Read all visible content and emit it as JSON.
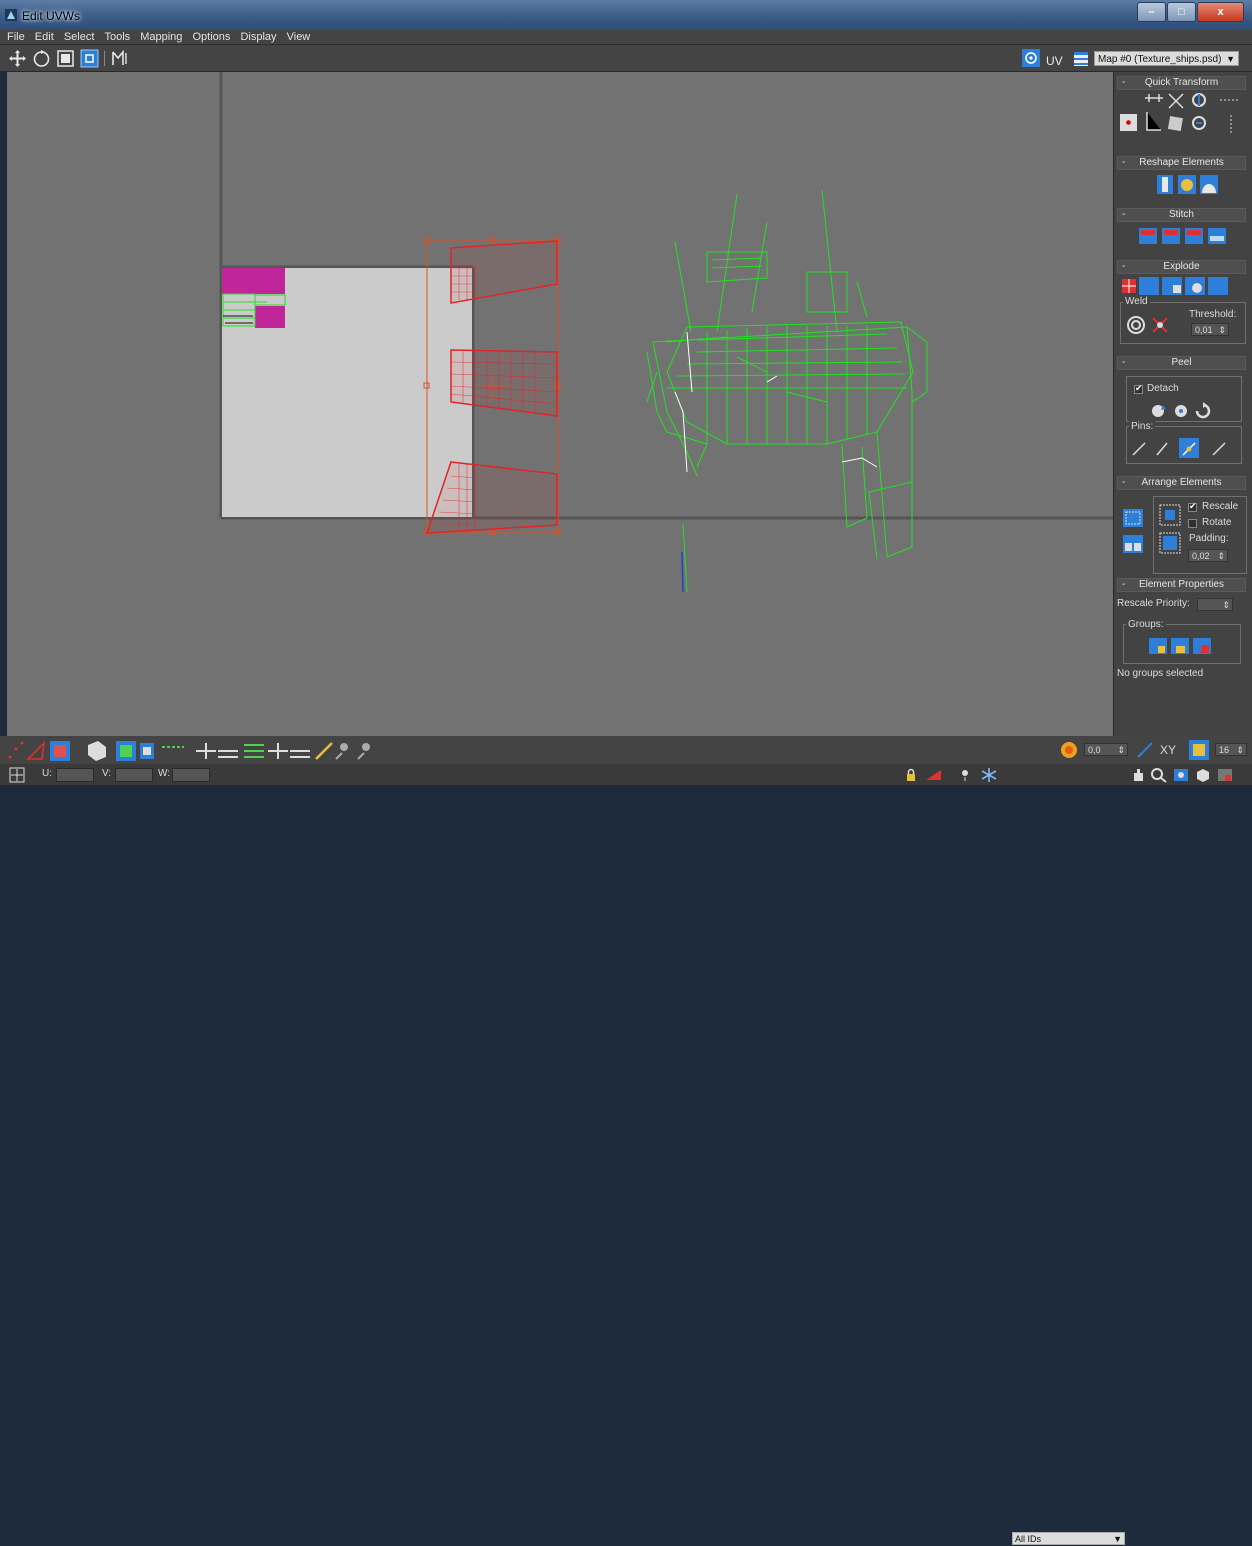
{
  "window": {
    "title": "Edit UVWs",
    "min": "–",
    "max": "□",
    "close": "x"
  },
  "menu": [
    "File",
    "Edit",
    "Select",
    "Tools",
    "Mapping",
    "Options",
    "Display",
    "View"
  ],
  "toolbar": {
    "icons": [
      "move-icon",
      "rotate-icon",
      "scale-icon",
      "freeform-icon",
      "mirror-icon"
    ],
    "uv_label": "UV",
    "map_select": "Map #0 (Texture_ships.psd)"
  },
  "panel": {
    "quick_transform": "Quick Transform",
    "reshape": "Reshape Elements",
    "stitch": "Stitch",
    "explode": "Explode",
    "weld": "Weld",
    "threshold_label": "Threshold:",
    "threshold_value": "0,01",
    "peel": "Peel",
    "detach": "Detach",
    "pins": "Pins:",
    "arrange": "Arrange Elements",
    "rescale": "Rescale",
    "rotate": "Rotate",
    "padding_label": "Padding:",
    "padding_value": "0,02",
    "element_props": "Element Properties",
    "rescale_priority": "Rescale Priority:",
    "groups": "Groups:",
    "no_groups": "No groups selected",
    "minus": "-"
  },
  "bottom": {
    "soft_value": "0,0",
    "xy": "XY",
    "grid_value": "16",
    "u_label": "U:",
    "v_label": "V:",
    "w_label": "W:",
    "ids_select": "All IDs"
  },
  "colors": {
    "viewport": "#727272",
    "selection": "#e0242a",
    "wireframe": "#22e222",
    "magenta": "#c0259a",
    "accent": "#2e7fd9"
  }
}
